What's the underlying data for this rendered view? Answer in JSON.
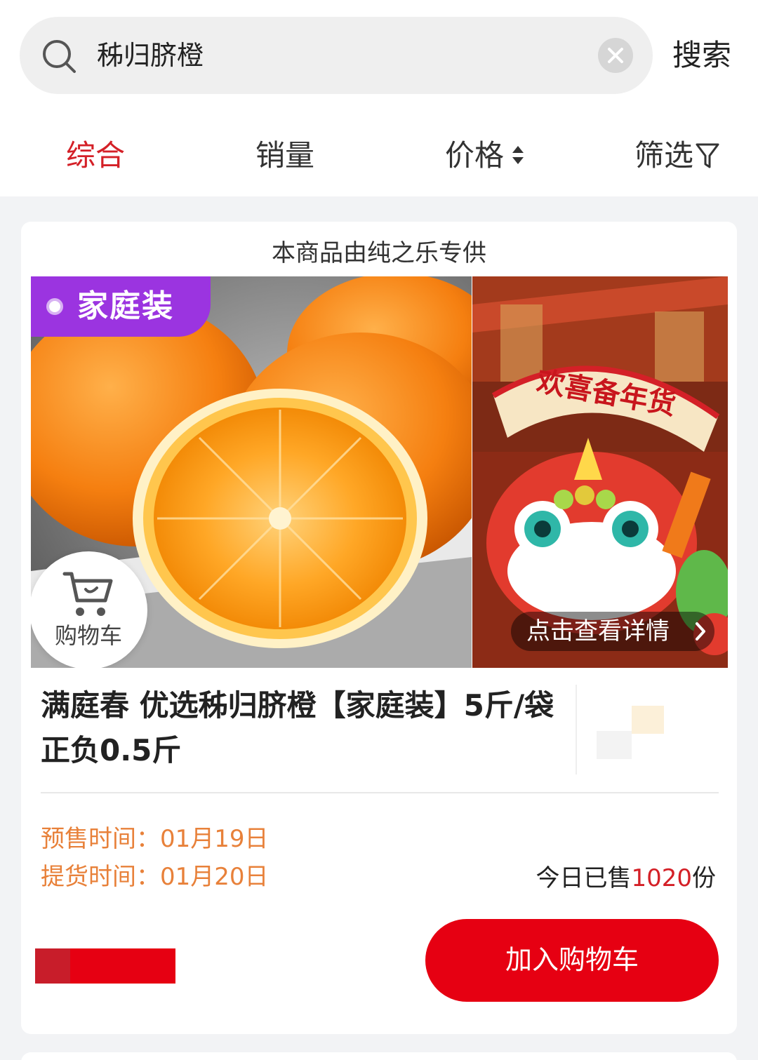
{
  "search": {
    "query": "秭归脐橙",
    "button_label": "搜索"
  },
  "sort_bar": {
    "items": [
      {
        "label": "综合",
        "active": true
      },
      {
        "label": "销量",
        "active": false
      },
      {
        "label": "价格",
        "active": false
      },
      {
        "label": "筛选",
        "active": false
      }
    ]
  },
  "product": {
    "supplier_notice": "本商品由纯之乐专供",
    "badge": "家庭装",
    "cart_float_label": "购物车",
    "banner_text": "欢喜备年货",
    "detail_label": "点击查看详情",
    "title": "满庭春 优选秭归脐橙【家庭装】5斤/袋正负0.5斤",
    "presale_time": "预售时间：01月19日",
    "pickup_time": "提货时间：01月20日",
    "sold_prefix": "今日已售",
    "sold_count": "1020",
    "sold_suffix": "份",
    "add_to_cart_label": "加入购物车"
  },
  "colors": {
    "accent": "#d42027",
    "button": "#e60012",
    "badge": "#9b34e0",
    "time_text": "#e8813a"
  }
}
